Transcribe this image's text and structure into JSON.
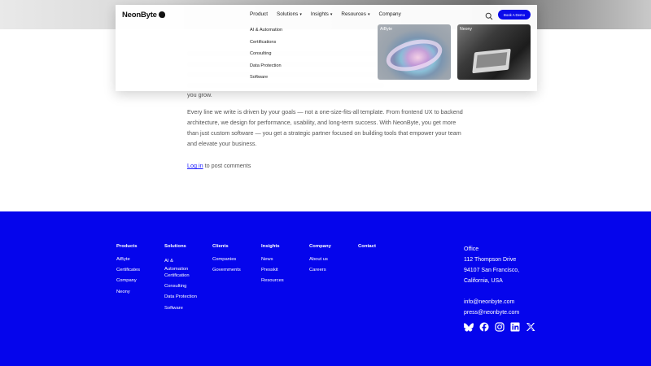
{
  "article": {
    "tail_text": "you grow.",
    "paragraph2": "Every line we write is driven by your goals — not a one-size-fits-all template. From frontend UX to backend architecture, we design for performance, usability, and long-term success. With NeonByte, you get more than just custom software — you get a strategic partner focused on building tools that empower your team and elevate your business.",
    "login_link": "Log in",
    "login_suffix": " to post comments"
  },
  "header": {
    "logo": "NeonByte",
    "nav": [
      {
        "label": "Product",
        "chevron": false
      },
      {
        "label": "Solutions",
        "chevron": true
      },
      {
        "label": "Insights",
        "chevron": true
      },
      {
        "label": "Resources",
        "chevron": true
      },
      {
        "label": "Company",
        "chevron": false
      }
    ],
    "chevron_glyph": "▾",
    "cta": "Book A Demo",
    "search_icon": "search-icon"
  },
  "submenu": {
    "items": [
      "AI & Automation",
      "Certifications",
      "Consulting",
      "Data Protection",
      "Software"
    ]
  },
  "cards": [
    {
      "label": "AiByte"
    },
    {
      "label": "Neony"
    }
  ],
  "footer": {
    "bg_color": "#0505ec",
    "columns": [
      {
        "title": "Products",
        "items": [
          "AiByte",
          "Certificates",
          "Company",
          "Neony"
        ]
      },
      {
        "title": "Solutions",
        "items": [
          "AI & Automation",
          "Certification",
          "Consulting",
          "Data Protection",
          "Software"
        ]
      },
      {
        "title": "Clients",
        "items": [
          "Companies",
          "Governments"
        ]
      },
      {
        "title": "Insights",
        "items": [
          "News",
          "Presskit",
          "Resources"
        ]
      },
      {
        "title": "Company",
        "items": [
          "About us",
          "Careers"
        ]
      },
      {
        "title": "Contact",
        "items": []
      }
    ],
    "office": {
      "label": "Office",
      "street": "112 Thompson Drive",
      "city": "94107 San Francisco,",
      "state": "California, USA",
      "email1": "info@neonbyte.com",
      "email2": "press@neonbyte.com"
    },
    "socials": [
      "bluesky-icon",
      "facebook-icon",
      "instagram-icon",
      "linkedin-icon",
      "x-icon"
    ]
  }
}
